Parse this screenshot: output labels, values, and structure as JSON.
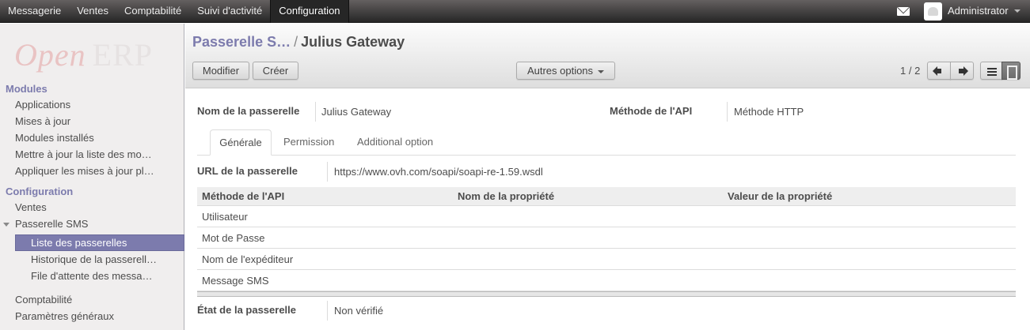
{
  "topbar": {
    "menu": [
      "Messagerie",
      "Ventes",
      "Comptabilité",
      "Suivi d'activité",
      "Configuration"
    ],
    "active": "Configuration",
    "user": "Administrator"
  },
  "sidebar": {
    "logo_open": "Open",
    "logo_erp": "ERP",
    "sections": [
      {
        "title": "Modules",
        "items": [
          "Applications",
          "Mises à jour",
          "Modules installés",
          "Mettre à jour la liste des mo…",
          "Appliquer les mises à jour pl…"
        ]
      },
      {
        "title": "Configuration",
        "items": [
          "Ventes",
          "Passerelle SMS"
        ]
      }
    ],
    "sms_children": [
      "Liste des passerelles",
      "Historique de la passerell…",
      "File d'attente des messa…"
    ],
    "bottom_items": [
      "Comptabilité",
      "Paramètres généraux"
    ]
  },
  "control_panel": {
    "breadcrumb_parent": "Passerelle S…",
    "breadcrumb_sep": "/",
    "breadcrumb_current": "Julius Gateway",
    "edit_label": "Modifier",
    "create_label": "Créer",
    "more_label": "Autres options",
    "pager": "1 / 2"
  },
  "form": {
    "name_label": "Nom de la passerelle",
    "name_value": "Julius Gateway",
    "method_label": "Méthode de l'API",
    "method_value": "Méthode HTTP",
    "tabs": [
      "Générale",
      "Permission",
      "Additional option"
    ],
    "url_label": "URL de la passerelle",
    "url_value": "https://www.ovh.com/soapi/soapi-re-1.59.wsdl",
    "grid_headers": [
      "Méthode de l'API",
      "Nom de la propriété",
      "Valeur de la propriété"
    ],
    "grid_rows": [
      "Utilisateur",
      "Mot de Passe",
      "Nom de l'expéditeur",
      "Message SMS"
    ],
    "state_label": "État de la passerelle",
    "state_value": "Non vérifié"
  },
  "colors": {
    "accent": "#7c7bad",
    "topbar": "#414141",
    "sidebar_bg": "#f0eeee"
  }
}
